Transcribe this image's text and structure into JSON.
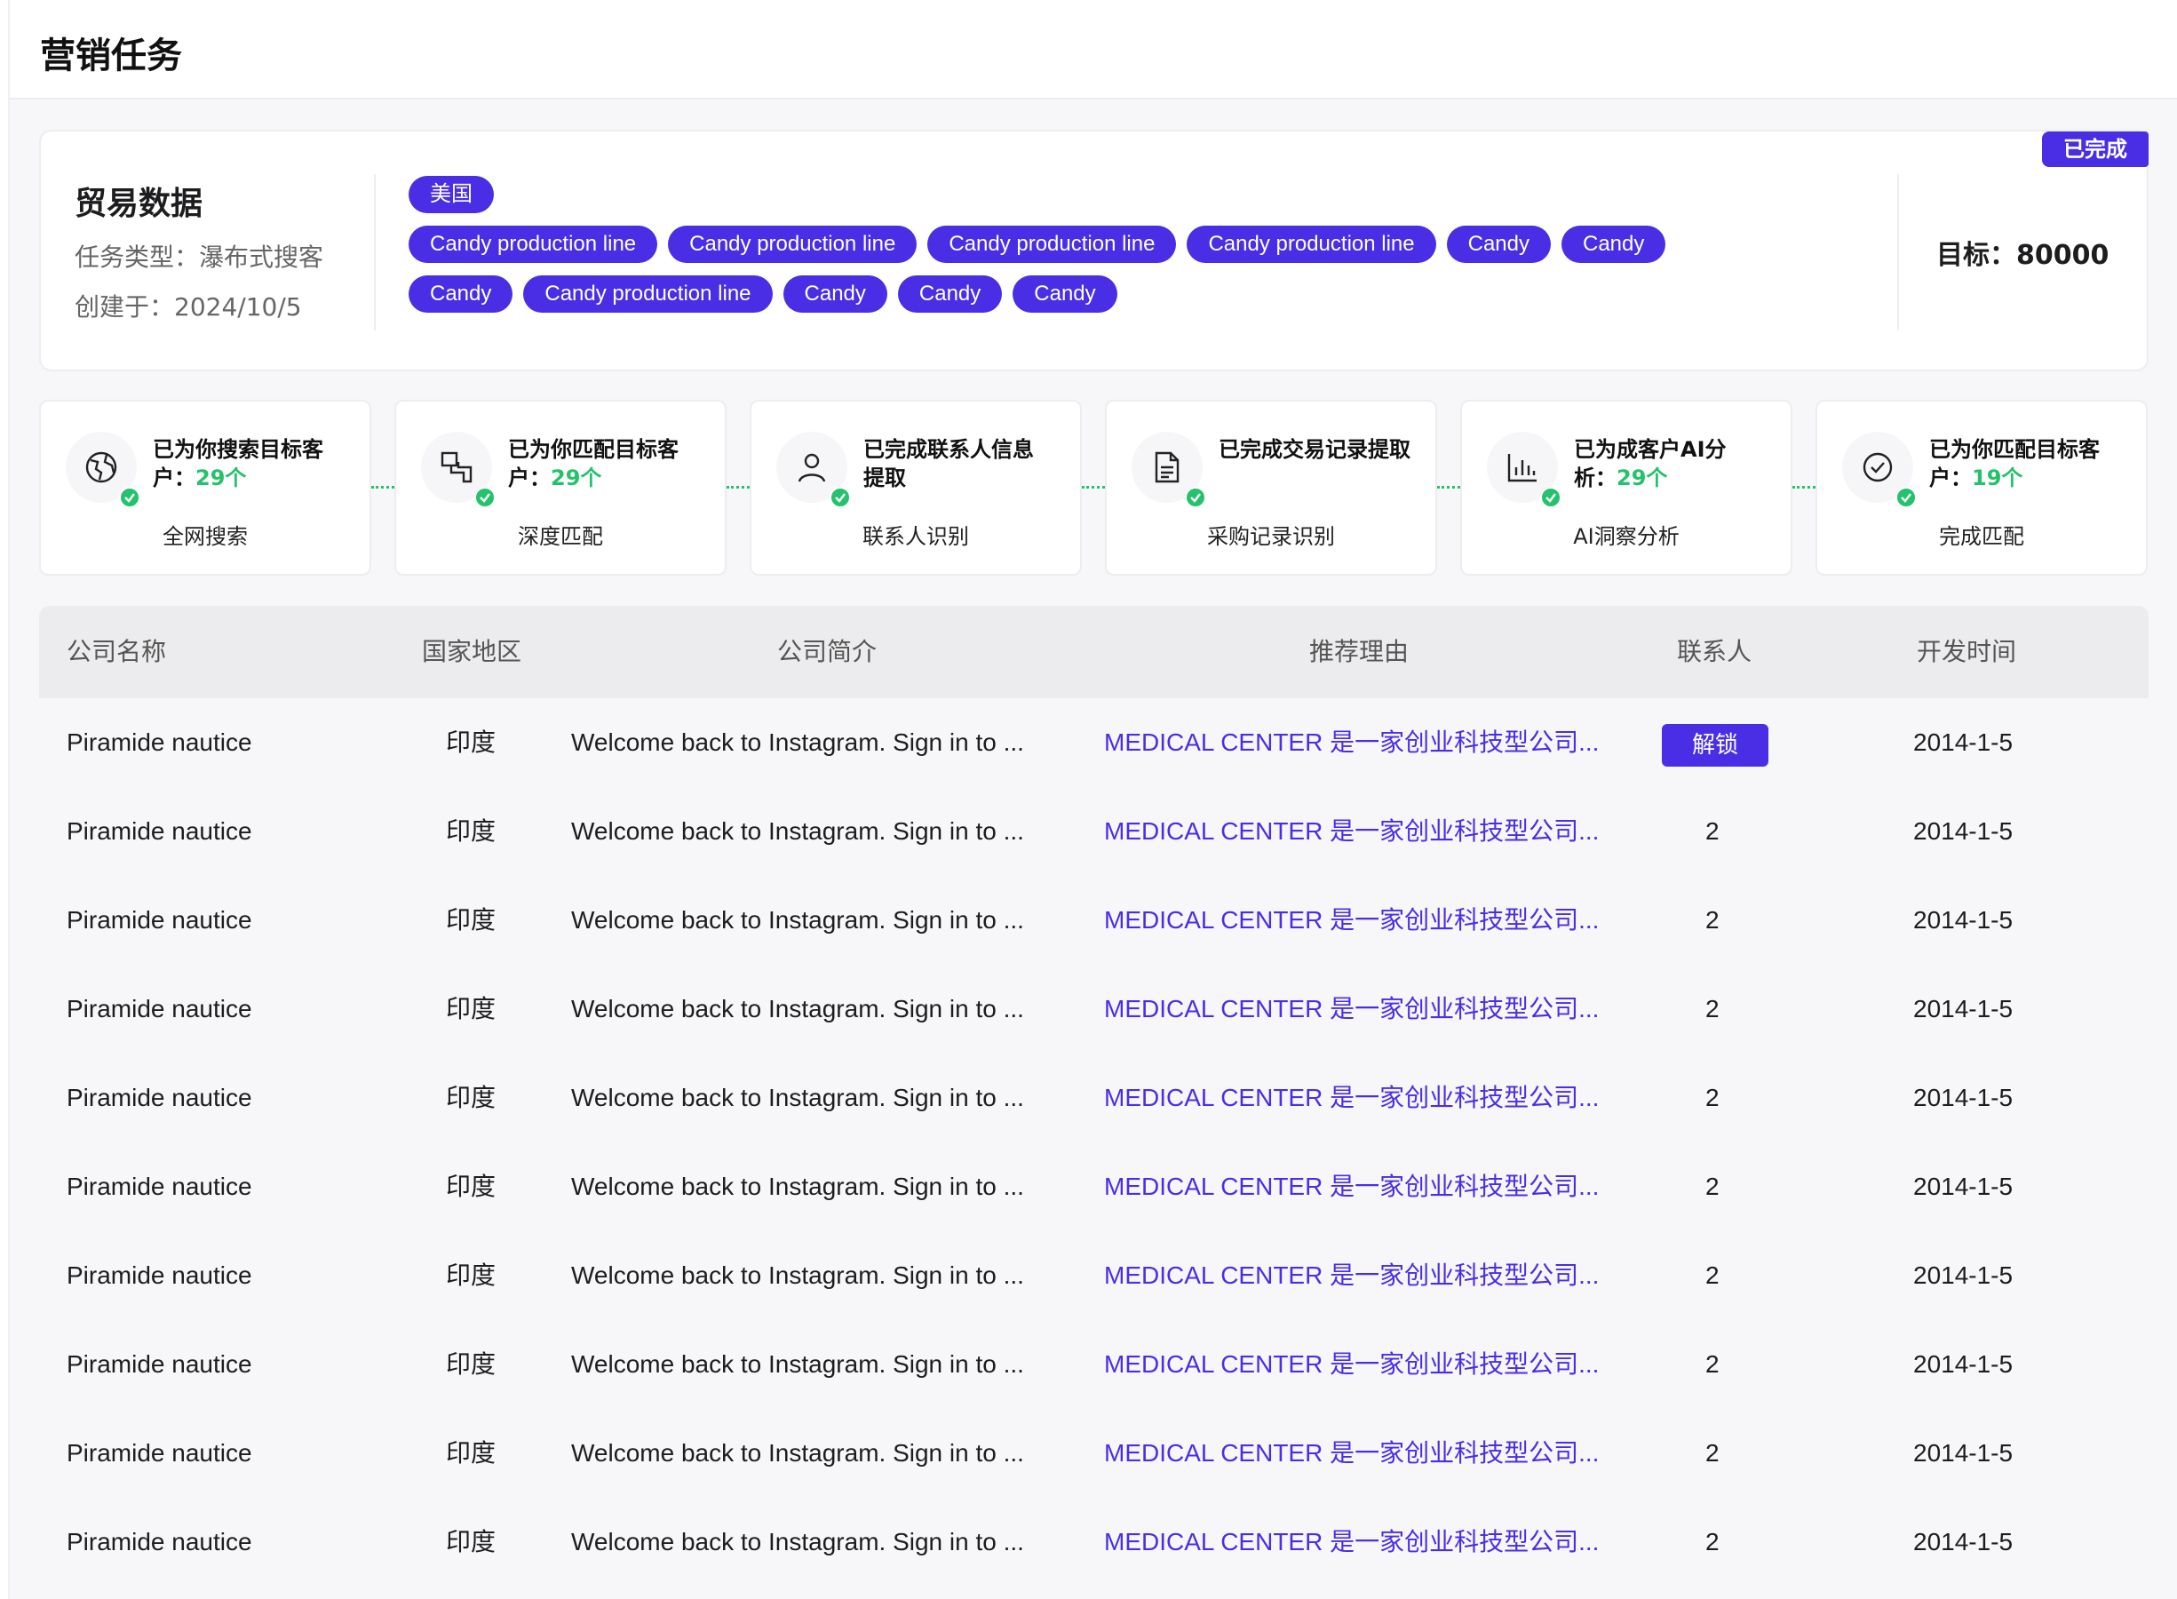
{
  "page": {
    "title": "营销任务"
  },
  "task": {
    "name": "贸易数据",
    "type_label": "任务类型：瀑布式搜客",
    "created_label": "创建于：2024/10/5",
    "status_badge": "已完成",
    "target_label": "目标：80000",
    "tag_rows": [
      [
        "美国"
      ],
      [
        "Candy production line",
        "Candy production line",
        "Candy production line",
        "Candy production line",
        "Candy",
        "Candy"
      ],
      [
        "Candy",
        "Candy production line",
        "Candy",
        "Candy",
        "Candy"
      ]
    ]
  },
  "steps": [
    {
      "title_a": "已为你搜索目标客",
      "title_b": "户：",
      "count": "29个",
      "label": "全网搜索",
      "icon": "globe-icon"
    },
    {
      "title_a": "已为你匹配目标客",
      "title_b": "户：",
      "count": "29个",
      "label": "深度匹配",
      "icon": "match-blocks-icon"
    },
    {
      "title_a": "已完成联系人信息",
      "title_b": "提取",
      "count": "",
      "label": "联系人识别",
      "icon": "person-icon"
    },
    {
      "title_a": "已完成交易记录提取",
      "title_b": "",
      "count": "",
      "label": "采购记录识别",
      "icon": "document-icon"
    },
    {
      "title_a": "已为成客户AI分",
      "title_b": "析：",
      "count": "29个",
      "label": "AI洞察分析",
      "icon": "bar-chart-icon"
    },
    {
      "title_a": "已为你匹配目标客",
      "title_b": "户：",
      "count": "19个",
      "label": "完成匹配",
      "icon": "check-circle-icon"
    }
  ],
  "table": {
    "headers": [
      "公司名称",
      "国家地区",
      "公司简介",
      "推荐理由",
      "联系人",
      "开发时间"
    ],
    "unlock_label": "解锁",
    "rows": [
      {
        "company": "Piramide  nautice",
        "country": "印度",
        "intro": "Welcome back to Instagram. Sign in to ...",
        "reason": "MEDICAL CENTER 是一家创业科技型公司...",
        "contacts": "",
        "date": "2014-1-5"
      },
      {
        "company": "Piramide  nautice",
        "country": "印度",
        "intro": "Welcome back to Instagram. Sign in to ...",
        "reason": "MEDICAL CENTER 是一家创业科技型公司...",
        "contacts": "2",
        "date": "2014-1-5"
      },
      {
        "company": "Piramide  nautice",
        "country": "印度",
        "intro": "Welcome back to Instagram. Sign in to ...",
        "reason": "MEDICAL CENTER 是一家创业科技型公司...",
        "contacts": "2",
        "date": "2014-1-5"
      },
      {
        "company": "Piramide  nautice",
        "country": "印度",
        "intro": "Welcome back to Instagram. Sign in to ...",
        "reason": "MEDICAL CENTER 是一家创业科技型公司...",
        "contacts": "2",
        "date": "2014-1-5"
      },
      {
        "company": "Piramide  nautice",
        "country": "印度",
        "intro": "Welcome back to Instagram. Sign in to ...",
        "reason": "MEDICAL CENTER 是一家创业科技型公司...",
        "contacts": "2",
        "date": "2014-1-5"
      },
      {
        "company": "Piramide  nautice",
        "country": "印度",
        "intro": "Welcome back to Instagram. Sign in to ...",
        "reason": "MEDICAL CENTER 是一家创业科技型公司...",
        "contacts": "2",
        "date": "2014-1-5"
      },
      {
        "company": "Piramide  nautice",
        "country": "印度",
        "intro": "Welcome back to Instagram. Sign in to ...",
        "reason": "MEDICAL CENTER 是一家创业科技型公司...",
        "contacts": "2",
        "date": "2014-1-5"
      },
      {
        "company": "Piramide  nautice",
        "country": "印度",
        "intro": "Welcome back to Instagram. Sign in to ...",
        "reason": "MEDICAL CENTER 是一家创业科技型公司...",
        "contacts": "2",
        "date": "2014-1-5"
      },
      {
        "company": "Piramide  nautice",
        "country": "印度",
        "intro": "Welcome back to Instagram. Sign in to ...",
        "reason": "MEDICAL CENTER 是一家创业科技型公司...",
        "contacts": "2",
        "date": "2014-1-5"
      },
      {
        "company": "Piramide  nautice",
        "country": "印度",
        "intro": "Welcome back to Instagram. Sign in to ...",
        "reason": "MEDICAL CENTER 是一家创业科技型公司...",
        "contacts": "2",
        "date": "2014-1-5"
      }
    ]
  }
}
